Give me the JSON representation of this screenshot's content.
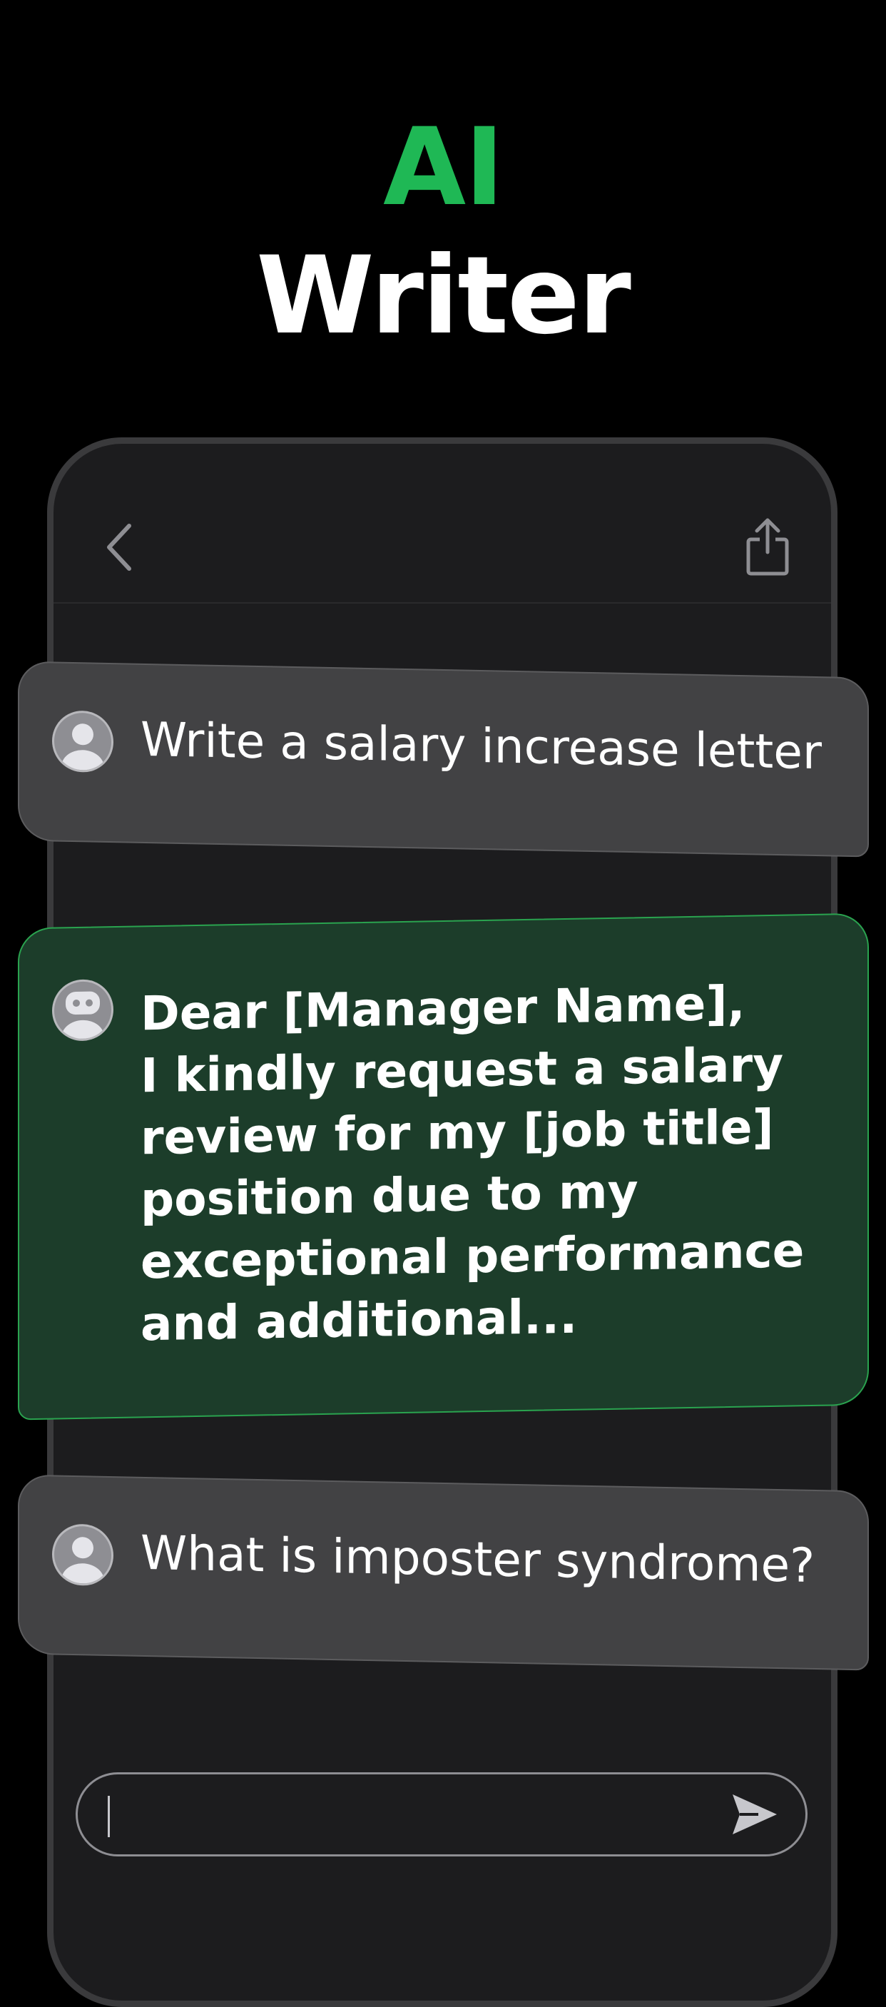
{
  "hero": {
    "title_accent": "AI",
    "title_main": "Writer"
  },
  "colors": {
    "background": "#000000",
    "accent_green": "#1fb855",
    "bot_bubble": "#1c3d2a",
    "user_bubble": "#424244"
  },
  "topbar": {
    "back_icon": "chevron-left-icon",
    "share_icon": "share-icon"
  },
  "messages": [
    {
      "role": "user",
      "avatar_icon": "user-avatar-icon",
      "text": "Write a salary increase letter"
    },
    {
      "role": "assistant",
      "avatar_icon": "robot-avatar-icon",
      "text": "Dear [Manager Name],\nI kindly request a salary review for my [job title] position due to my exceptional performance and additional..."
    },
    {
      "role": "user",
      "avatar_icon": "user-avatar-icon",
      "text": "What is imposter syndrome?"
    }
  ],
  "composer": {
    "value": "",
    "send_icon": "send-icon"
  }
}
